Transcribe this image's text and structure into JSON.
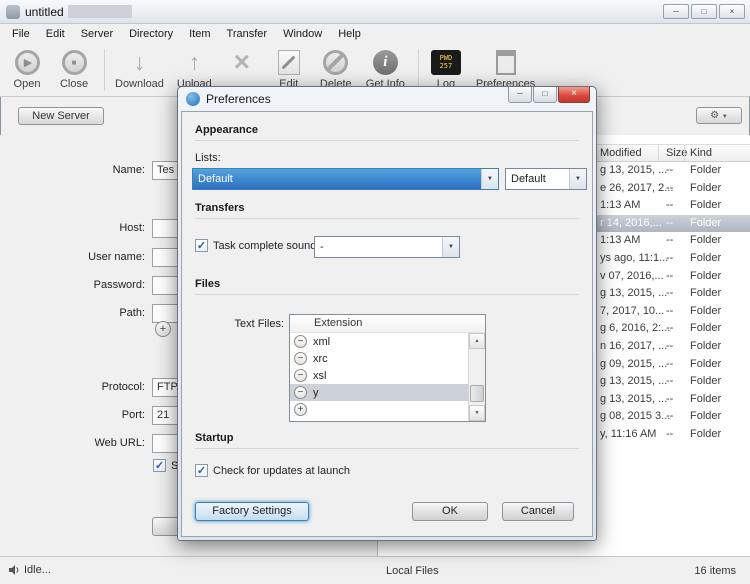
{
  "icons": {
    "play": "▶",
    "stop": "■",
    "down_arrow": "↓",
    "up_arrow": "↑",
    "x_mark": "×",
    "info": "i",
    "gear": "⚙",
    "combo_arrow": "▼",
    "check": "✓",
    "minus": "−",
    "plus": "+",
    "scroll_up": "▲",
    "scroll_down": "▼",
    "minimize": "─",
    "maximize": "□",
    "close": "×"
  },
  "window": {
    "title": "untitled"
  },
  "menu": {
    "items": [
      "File",
      "Edit",
      "Server",
      "Directory",
      "Item",
      "Transfer",
      "Window",
      "Help"
    ]
  },
  "toolbar": {
    "open": "Open",
    "close": "Close",
    "download": "Download",
    "upload": "Upload",
    "x": "",
    "edit": "Edit",
    "delete": "Delete",
    "getinfo": "Get Info",
    "log": "Log",
    "preferences": "Preferences",
    "log_badge_top": "PWD",
    "log_badge_bottom": "257"
  },
  "browser": {
    "new_server": "New Server",
    "form": {
      "name_label": "Name:",
      "name_value": "Tes",
      "host_label": "Host:",
      "host_value": "",
      "username_label": "User name:",
      "username_value": "",
      "password_label": "Password:",
      "password_value": "",
      "path_label": "Path:",
      "path_value": "",
      "protocol_label": "Protocol:",
      "protocol_value": "FTP",
      "port_label": "Port:",
      "port_value": "21",
      "weburl_label": "Web URL:",
      "weburl_value": "",
      "checkbox_label": "Sh",
      "bottom_button_label": ""
    },
    "filelist": {
      "col_modified": "Modified",
      "col_size": "Size",
      "col_kind": "Kind",
      "rows": [
        {
          "modified": "g 13, 2015, ...",
          "size": "--",
          "kind": "Folder"
        },
        {
          "modified": "e 26, 2017, 2...",
          "size": "--",
          "kind": "Folder"
        },
        {
          "modified": "1:13 AM",
          "size": "--",
          "kind": "Folder"
        },
        {
          "modified": "r 14, 2016,...",
          "size": "--",
          "kind": "Folder"
        },
        {
          "modified": "1:13 AM",
          "size": "--",
          "kind": "Folder"
        },
        {
          "modified": "ys ago, 11:1...",
          "size": "--",
          "kind": "Folder"
        },
        {
          "modified": "v 07, 2016,...",
          "size": "--",
          "kind": "Folder"
        },
        {
          "modified": "g 13, 2015, ...",
          "size": "--",
          "kind": "Folder"
        },
        {
          "modified": "7, 2017, 10...",
          "size": "--",
          "kind": "Folder"
        },
        {
          "modified": "g 6, 2016, 2:...",
          "size": "--",
          "kind": "Folder"
        },
        {
          "modified": "n 16, 2017, ...",
          "size": "--",
          "kind": "Folder"
        },
        {
          "modified": "g 09, 2015, ...",
          "size": "--",
          "kind": "Folder"
        },
        {
          "modified": "g 13, 2015, ...",
          "size": "--",
          "kind": "Folder"
        },
        {
          "modified": "g 13, 2015, ...",
          "size": "--",
          "kind": "Folder"
        },
        {
          "modified": "g 08, 2015 3...",
          "size": "--",
          "kind": "Folder"
        },
        {
          "modified": "y, 11:16 AM",
          "size": "--",
          "kind": "Folder"
        }
      ]
    },
    "status": {
      "idle": "Idle...",
      "local": "Local Files",
      "count": "16 items"
    }
  },
  "prefs": {
    "title": "Preferences",
    "appearance": "Appearance",
    "transfers": "Transfers",
    "files": "Files",
    "startup": "Startup",
    "lists_label": "Lists:",
    "list_combo_primary": "Default",
    "list_combo_secondary": "Default",
    "task_sound_label": "Task complete sound:",
    "task_sound_value": "-",
    "text_files_label": "Text Files:",
    "extension_col": "Extension",
    "extensions": [
      "xml",
      "xrc",
      "xsl",
      "y"
    ],
    "updates_label": "Check for updates at launch",
    "factory": "Factory Settings",
    "ok": "OK",
    "cancel": "Cancel"
  }
}
